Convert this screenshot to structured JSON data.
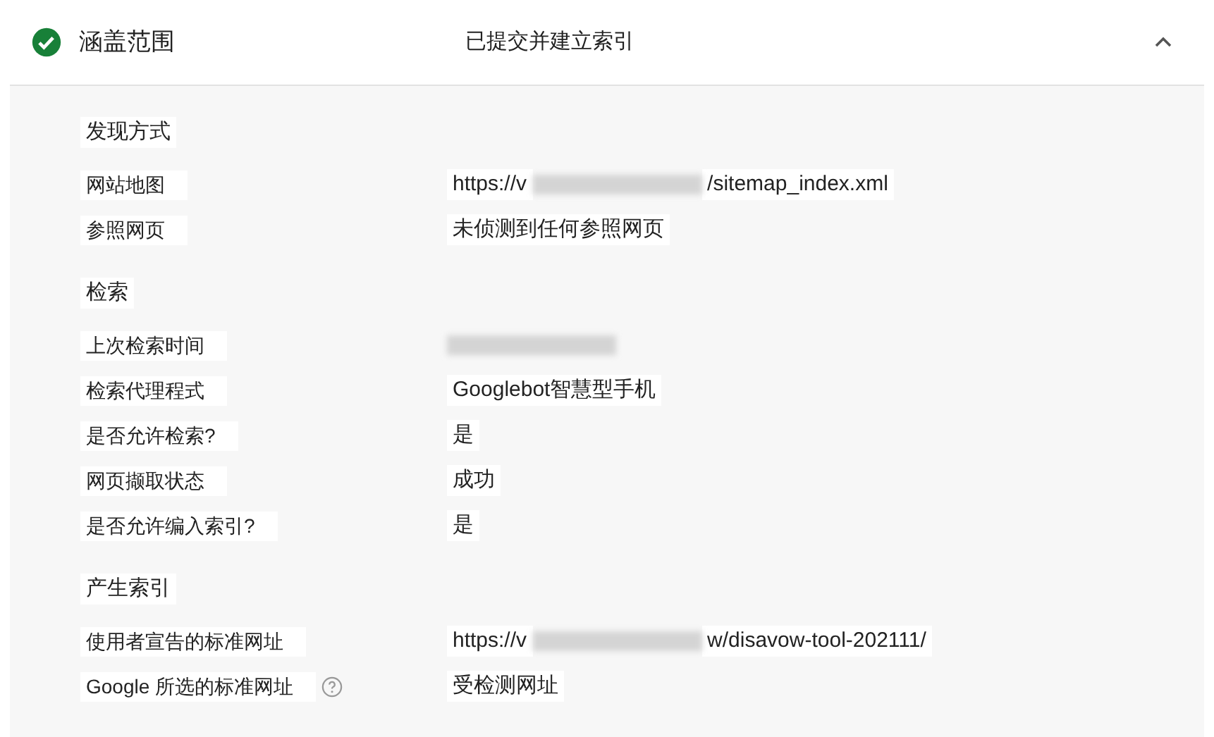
{
  "header": {
    "title": "涵盖范围",
    "status": "已提交并建立索引",
    "expanded": true
  },
  "sections": [
    {
      "heading": "发现方式",
      "rows": [
        {
          "label": "网站地图",
          "value": [
            {
              "kind": "text",
              "text": "https://v"
            },
            {
              "kind": "redacted"
            },
            {
              "kind": "text",
              "text": "/sitemap_index.xml"
            }
          ]
        },
        {
          "label": "参照网页",
          "value": [
            {
              "kind": "text",
              "text": "未侦测到任何参照网页"
            }
          ]
        }
      ]
    },
    {
      "heading": "检索",
      "rows": [
        {
          "label": "上次检索时间",
          "value": [
            {
              "kind": "redacted"
            }
          ]
        },
        {
          "label": "检索代理程式",
          "value": [
            {
              "kind": "text",
              "text": "Googlebot智慧型手机"
            }
          ]
        },
        {
          "label": "是否允许检索?",
          "value": [
            {
              "kind": "text",
              "text": "是"
            }
          ]
        },
        {
          "label": "网页撷取状态",
          "value": [
            {
              "kind": "text",
              "text": "成功"
            }
          ]
        },
        {
          "label": "是否允许编入索引?",
          "value": [
            {
              "kind": "text",
              "text": "是"
            }
          ]
        }
      ]
    },
    {
      "heading": "产生索引",
      "rows": [
        {
          "label": "使用者宣告的标准网址",
          "value": [
            {
              "kind": "text",
              "text": "https://v"
            },
            {
              "kind": "redacted"
            },
            {
              "kind": "text",
              "text": "w/disavow-tool-202111/"
            }
          ]
        },
        {
          "label": "Google 所选的标准网址",
          "help": true,
          "value": [
            {
              "kind": "text",
              "text": "受检测网址"
            }
          ]
        }
      ]
    }
  ]
}
